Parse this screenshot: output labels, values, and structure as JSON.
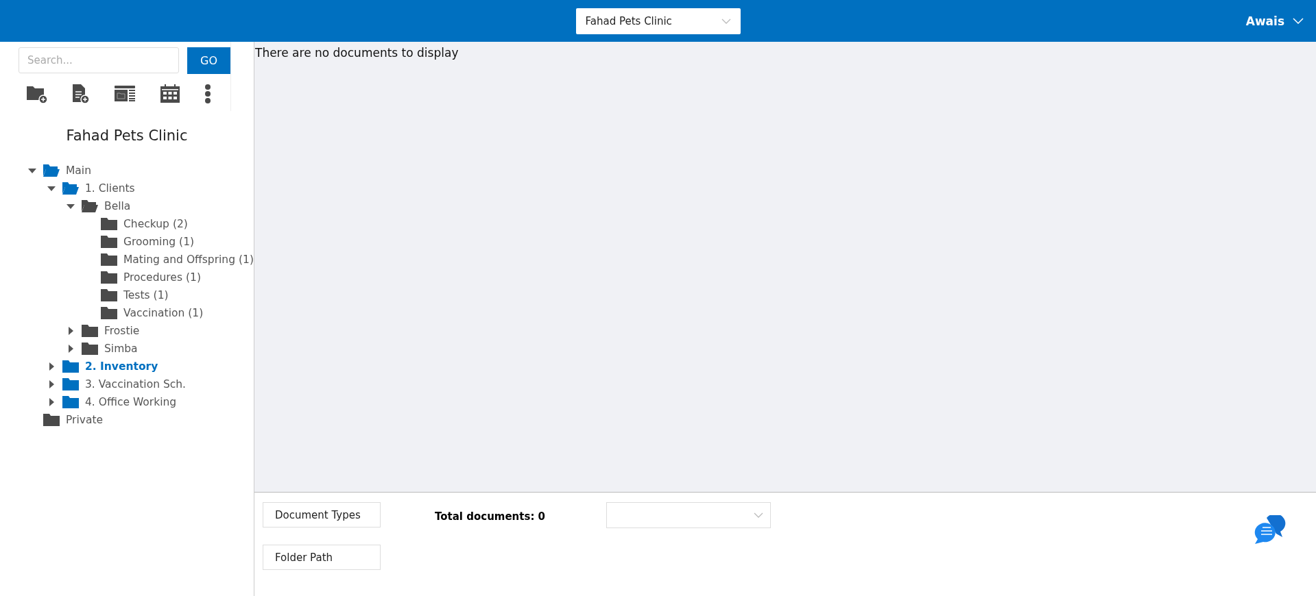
{
  "header": {
    "workspace_select": "Fahad Pets Clinic",
    "user": "Awais"
  },
  "sidebar": {
    "search": {
      "placeholder": "Search...",
      "button": "GO"
    },
    "title": "Fahad Pets Clinic",
    "tree": [
      {
        "label": "Main",
        "color": "#0070c0",
        "expanded": true,
        "selected": false,
        "children": [
          {
            "label": "1. Clients",
            "color": "#0070c0",
            "expanded": true,
            "selected": false,
            "children": [
              {
                "label": "Bella",
                "color": "#4a4a4a",
                "expanded": true,
                "selected": false,
                "children": [
                  {
                    "label": "Checkup",
                    "count": "(2)",
                    "color": "#4a4a4a",
                    "selected": false
                  },
                  {
                    "label": "Grooming",
                    "count": "(1)",
                    "color": "#4a4a4a",
                    "selected": false
                  },
                  {
                    "label": "Mating and Offspring",
                    "count": "(1)",
                    "color": "#4a4a4a",
                    "selected": false
                  },
                  {
                    "label": "Procedures",
                    "count": "(1)",
                    "color": "#4a4a4a",
                    "selected": false
                  },
                  {
                    "label": "Tests",
                    "count": "(1)",
                    "color": "#4a4a4a",
                    "selected": false
                  },
                  {
                    "label": "Vaccination",
                    "count": "(1)",
                    "color": "#4a4a4a",
                    "selected": false
                  }
                ]
              },
              {
                "label": "Frostie",
                "color": "#4a4a4a",
                "expanded": false,
                "selected": false
              },
              {
                "label": "Simba",
                "color": "#4a4a4a",
                "expanded": false,
                "selected": false
              }
            ]
          },
          {
            "label": "2. Inventory",
            "color": "#0070c0",
            "expanded": false,
            "selected": true
          },
          {
            "label": "3. Vaccination Sch.",
            "color": "#0070c0",
            "expanded": false,
            "selected": false
          },
          {
            "label": "4. Office Working",
            "color": "#0070c0",
            "expanded": false,
            "selected": false
          }
        ]
      },
      {
        "label": "Private",
        "color": "#4a4a4a",
        "selected": false
      }
    ]
  },
  "content": {
    "message": "There are no documents to display"
  },
  "footer": {
    "buttons": [
      "Document Types",
      "Folder Path"
    ],
    "total": "Total documents: 0"
  }
}
